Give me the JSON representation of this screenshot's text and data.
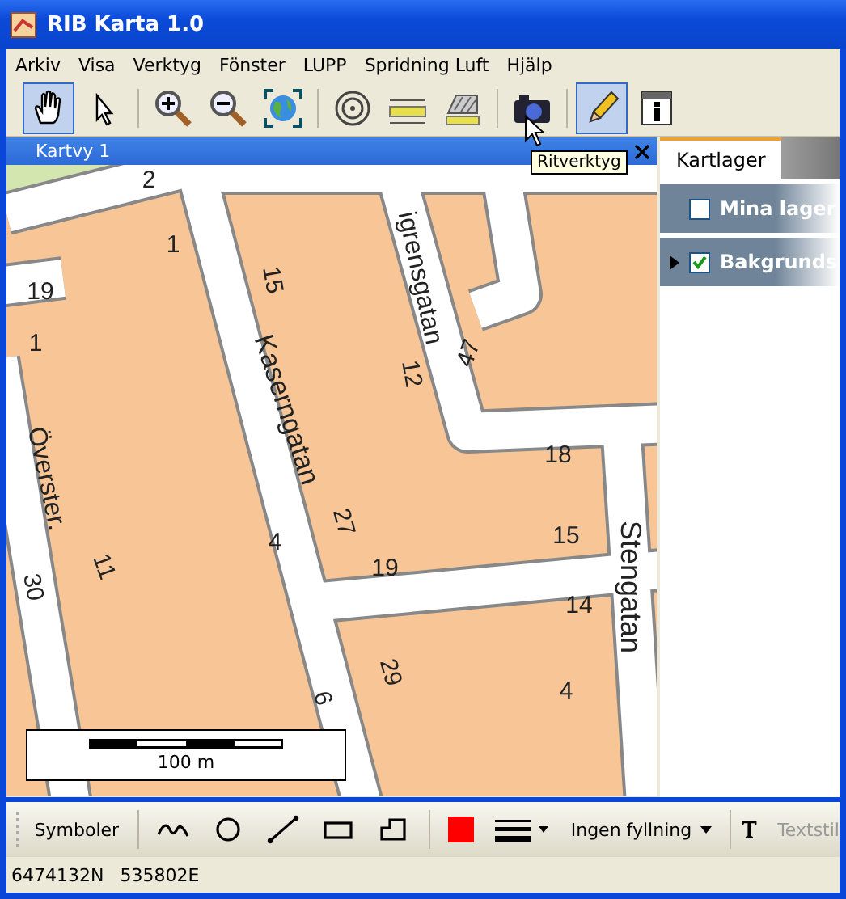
{
  "window": {
    "title": "RIB Karta 1.0"
  },
  "menu": [
    "Arkiv",
    "Visa",
    "Verktyg",
    "Fönster",
    "LUPP",
    "Spridning Luft",
    "Hjälp"
  ],
  "toolbar": [
    {
      "kind": "hand",
      "selected": true
    },
    {
      "kind": "pointer",
      "selected": false
    },
    {
      "kind": "sep"
    },
    {
      "kind": "zoom-in",
      "selected": false
    },
    {
      "kind": "zoom-out",
      "selected": false
    },
    {
      "kind": "globe",
      "selected": false
    },
    {
      "kind": "sep"
    },
    {
      "kind": "target",
      "selected": false
    },
    {
      "kind": "ruler",
      "selected": false
    },
    {
      "kind": "area",
      "selected": false
    },
    {
      "kind": "sep"
    },
    {
      "kind": "camera",
      "selected": false
    },
    {
      "kind": "sep"
    },
    {
      "kind": "pencil",
      "selected": true
    },
    {
      "kind": "info",
      "selected": false
    }
  ],
  "tooltip": "Ritverktyg",
  "map_view": {
    "title": "Kartvy 1",
    "labels": [
      {
        "kind": "street",
        "text": "Kaserngatan"
      },
      {
        "kind": "street",
        "text": "igrensgatan"
      },
      {
        "kind": "street",
        "text": "Stengatan"
      },
      {
        "kind": "street",
        "text": "Överster."
      },
      {
        "kind": "number",
        "text": "2"
      },
      {
        "kind": "number",
        "text": "1"
      },
      {
        "kind": "number",
        "text": "19"
      },
      {
        "kind": "number",
        "text": "1"
      },
      {
        "kind": "number",
        "text": "15"
      },
      {
        "kind": "number",
        "text": "47"
      },
      {
        "kind": "number",
        "text": "12"
      },
      {
        "kind": "number",
        "text": "18"
      },
      {
        "kind": "number",
        "text": "27"
      },
      {
        "kind": "number",
        "text": "4"
      },
      {
        "kind": "number",
        "text": "11"
      },
      {
        "kind": "number",
        "text": "30"
      },
      {
        "kind": "number",
        "text": "19"
      },
      {
        "kind": "number",
        "text": "15"
      },
      {
        "kind": "number",
        "text": "14"
      },
      {
        "kind": "number",
        "text": "29"
      },
      {
        "kind": "number",
        "text": "6"
      },
      {
        "kind": "number",
        "text": "4"
      }
    ],
    "scale_bar": "100 m"
  },
  "layers_panel": {
    "tabs": [
      {
        "label": "Kartlager",
        "selected": true
      }
    ],
    "layers": [
      {
        "name": "Mina lager",
        "checked": false,
        "expandable": false
      },
      {
        "name": "Bakgrunds",
        "checked": true,
        "expandable": true
      }
    ]
  },
  "draw_toolbar": {
    "label": "Symboler",
    "tools": [
      {
        "kind": "freehand"
      },
      {
        "kind": "circle"
      },
      {
        "kind": "line"
      },
      {
        "kind": "rectangle"
      },
      {
        "kind": "polygon"
      }
    ],
    "color": "#ff0000",
    "fill": "Ingen fyllning",
    "text_style": "Textstil"
  },
  "status_bar": [
    "6474132N",
    "535802E"
  ]
}
